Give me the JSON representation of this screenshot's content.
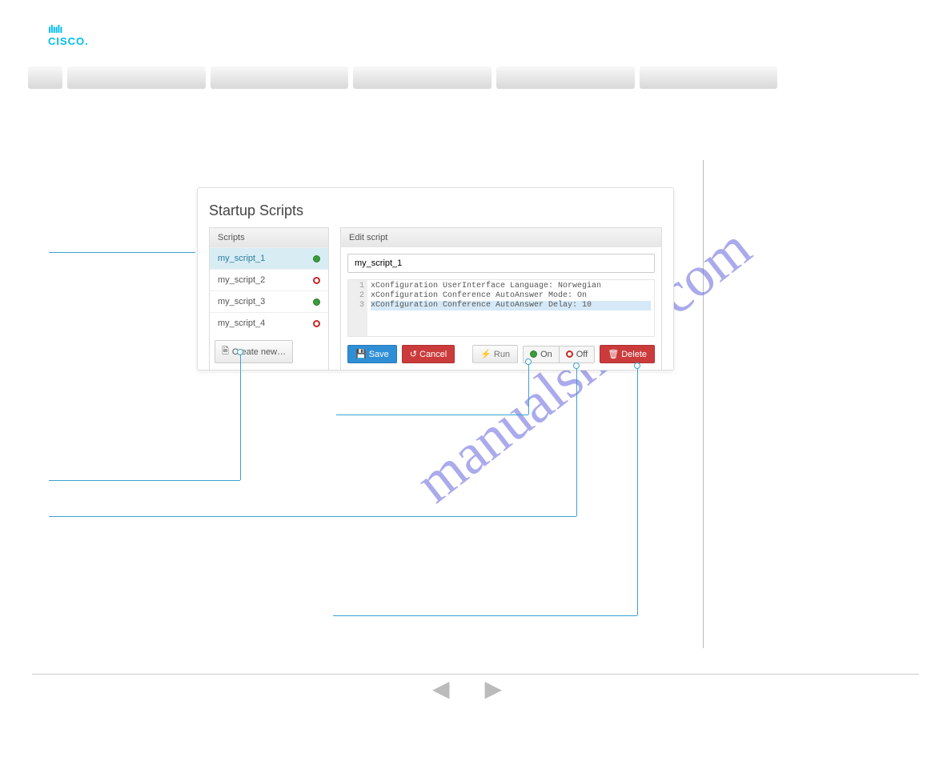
{
  "watermark": "manualshive.com",
  "logo_text": "CISCO.",
  "screenshot": {
    "title": "Startup Scripts",
    "left_header": "Scripts",
    "right_header": "Edit script",
    "scripts": [
      {
        "name": "my_script_1",
        "on": true,
        "selected": true
      },
      {
        "name": "my_script_2",
        "on": false,
        "selected": false
      },
      {
        "name": "my_script_3",
        "on": true,
        "selected": false
      },
      {
        "name": "my_script_4",
        "on": false,
        "selected": false
      }
    ],
    "create_label": "Create new…",
    "field_value": "my_script_1",
    "code_lines": [
      "xConfiguration UserInterface Language: Norwegian",
      "xConfiguration Conference AutoAnswer Mode: On",
      "xConfiguration Conference AutoAnswer Delay: 10"
    ],
    "buttons": {
      "save": "Save",
      "cancel": "Cancel",
      "run": "Run",
      "on": "On",
      "off": "Off",
      "delete": "Delete"
    }
  }
}
